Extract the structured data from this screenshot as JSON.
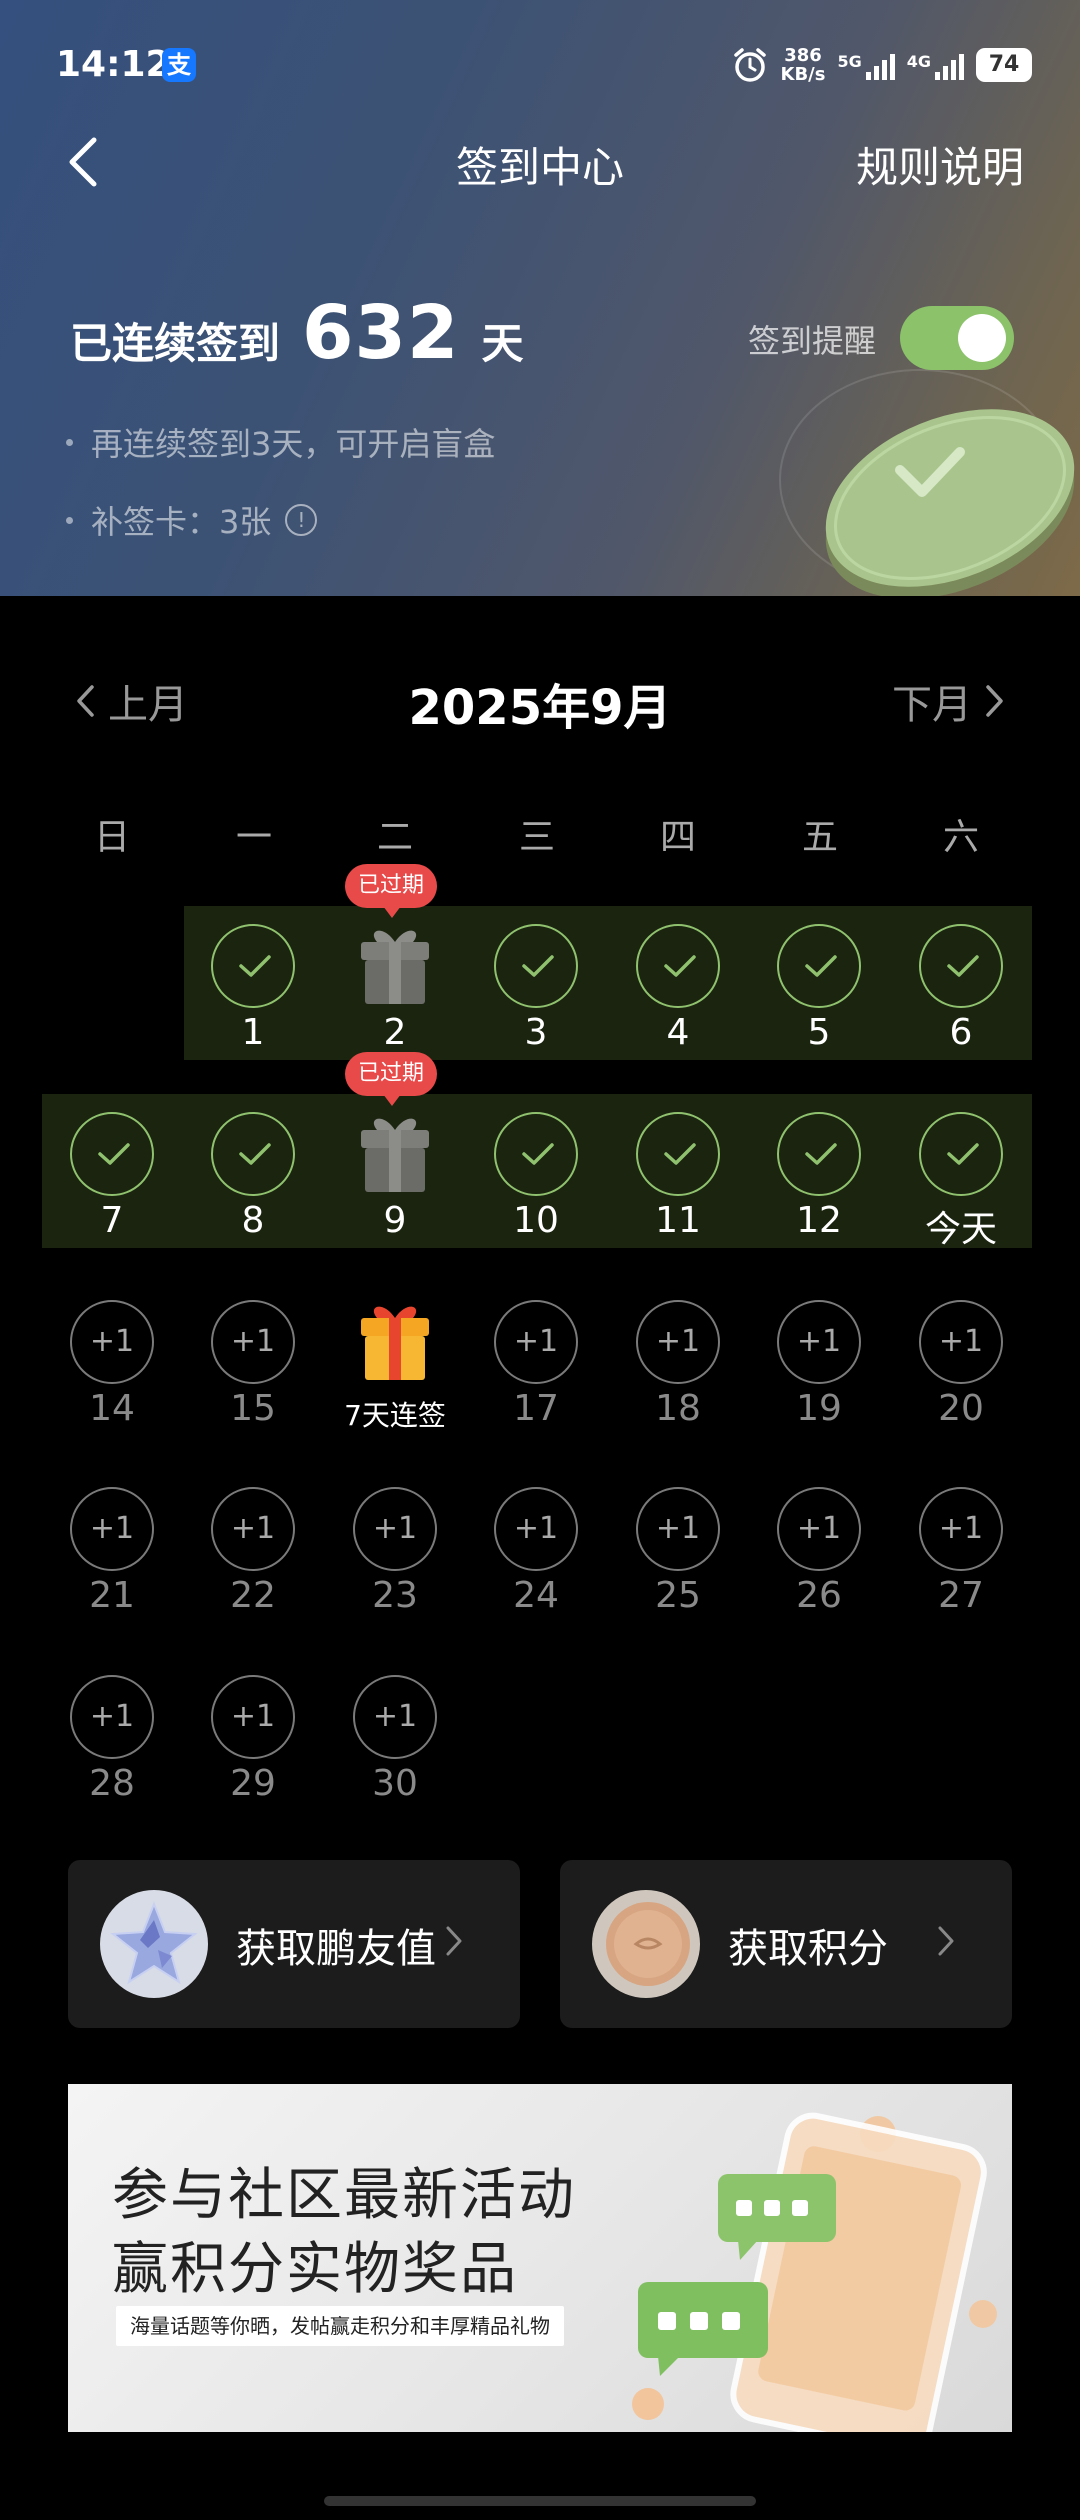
{
  "status_bar": {
    "time": "14:12",
    "alipay_glyph": "支",
    "speed_value": "386",
    "speed_unit": "KB/s",
    "net1": "5G",
    "net2": "4G",
    "battery": "74"
  },
  "header": {
    "title": "签到中心",
    "rules": "规则说明",
    "streak_prefix": "已连续签到",
    "streak_days": "632",
    "streak_suffix": "天",
    "remind_label": "签到提醒",
    "remind_on": true,
    "tips": [
      "再连续签到3天，可开启盲盒",
      "补签卡：3张"
    ]
  },
  "calendar": {
    "prev": "上月",
    "next": "下月",
    "title": "2025年9月",
    "weekdays": [
      "日",
      "一",
      "二",
      "三",
      "四",
      "五",
      "六"
    ],
    "expired_label": "已过期",
    "future_reward": "+1",
    "days": [
      {
        "label": "1",
        "state": "done"
      },
      {
        "label": "2",
        "state": "expired-gift"
      },
      {
        "label": "3",
        "state": "done"
      },
      {
        "label": "4",
        "state": "done"
      },
      {
        "label": "5",
        "state": "done"
      },
      {
        "label": "6",
        "state": "done"
      },
      {
        "label": "7",
        "state": "done"
      },
      {
        "label": "8",
        "state": "done"
      },
      {
        "label": "9",
        "state": "expired-gift"
      },
      {
        "label": "10",
        "state": "done"
      },
      {
        "label": "11",
        "state": "done"
      },
      {
        "label": "12",
        "state": "done"
      },
      {
        "label": "今天",
        "state": "done"
      },
      {
        "label": "14",
        "state": "future"
      },
      {
        "label": "15",
        "state": "future"
      },
      {
        "label": "7天连签",
        "state": "gift"
      },
      {
        "label": "17",
        "state": "future"
      },
      {
        "label": "18",
        "state": "future"
      },
      {
        "label": "19",
        "state": "future"
      },
      {
        "label": "20",
        "state": "future"
      },
      {
        "label": "21",
        "state": "future"
      },
      {
        "label": "22",
        "state": "future"
      },
      {
        "label": "23",
        "state": "future"
      },
      {
        "label": "24",
        "state": "future"
      },
      {
        "label": "25",
        "state": "future"
      },
      {
        "label": "26",
        "state": "future"
      },
      {
        "label": "27",
        "state": "future"
      },
      {
        "label": "28",
        "state": "future"
      },
      {
        "label": "29",
        "state": "future"
      },
      {
        "label": "30",
        "state": "future"
      }
    ]
  },
  "actions": [
    {
      "label": "获取鹏友值",
      "icon": "star-icon"
    },
    {
      "label": "获取积分",
      "icon": "coin-icon"
    }
  ],
  "banner": {
    "line1": "参与社区最新活动",
    "line2": "赢积分实物奖品",
    "subtitle": "海量话题等你晒，发帖赢走积分和丰厚精品礼物"
  },
  "colors": {
    "accent_green": "#8fc16e",
    "expired_red": "#e84a4a",
    "band": "#1a240f"
  }
}
